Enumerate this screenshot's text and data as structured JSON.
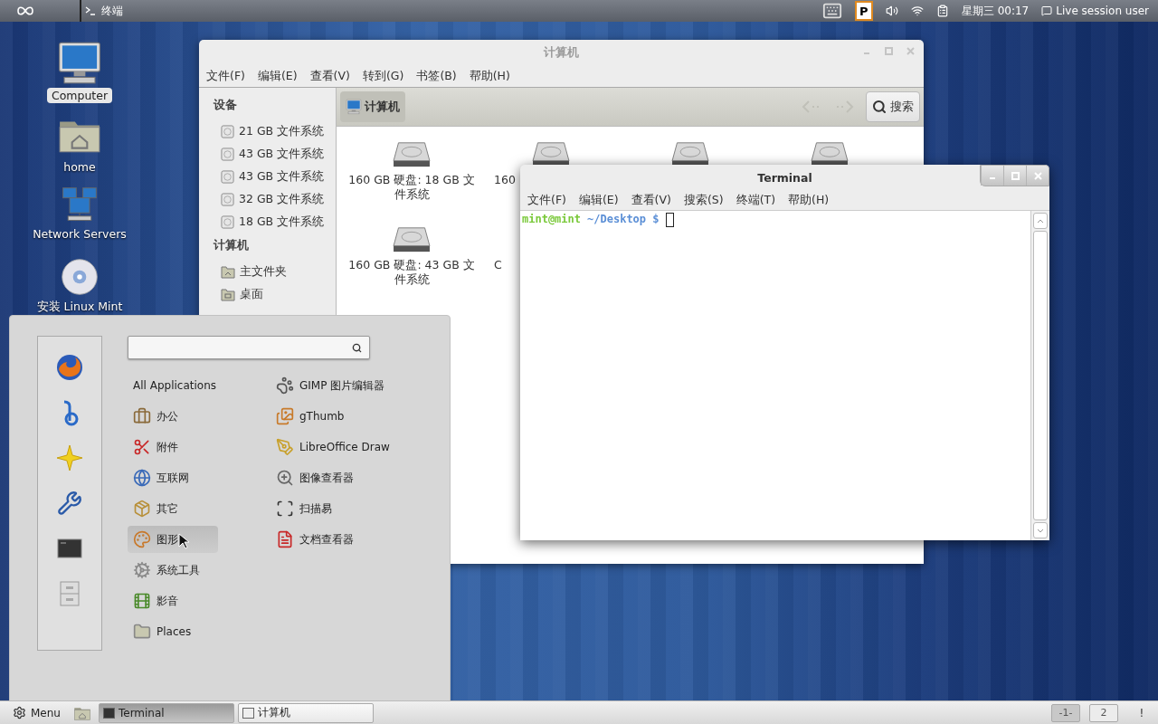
{
  "top_panel": {
    "window_list": [
      {
        "label": "终端"
      }
    ],
    "indicator": "P",
    "clock": "星期三 00:17",
    "user": "Live session user"
  },
  "desktop_icons": [
    {
      "label": "Computer",
      "kind": "computer",
      "selected": true
    },
    {
      "label": "home",
      "kind": "home",
      "selected": false
    },
    {
      "label": "Network Servers",
      "kind": "network",
      "selected": false
    },
    {
      "label": "安装 Linux Mint",
      "kind": "disc",
      "selected": false
    }
  ],
  "file_manager": {
    "title": "计算机",
    "menu": [
      "文件(F)",
      "编辑(E)",
      "查看(V)",
      "转到(G)",
      "书签(B)",
      "帮助(H)"
    ],
    "location": "计算机",
    "search_button": "搜索",
    "sidebar": [
      {
        "heading": "设备",
        "items": [
          {
            "label": "21 GB 文件系统",
            "kind": "drive"
          },
          {
            "label": "43 GB 文件系统",
            "kind": "drive"
          },
          {
            "label": "43 GB 文件系统",
            "kind": "drive"
          },
          {
            "label": "32 GB 文件系统",
            "kind": "drive"
          },
          {
            "label": "18 GB 文件系统",
            "kind": "drive"
          }
        ]
      },
      {
        "heading": "计算机",
        "items": [
          {
            "label": "主文件夹",
            "kind": "home"
          },
          {
            "label": "桌面",
            "kind": "folder"
          }
        ]
      }
    ],
    "items": [
      {
        "kind": "drive",
        "label": "160 GB 硬盘: 18 GB 文件系统"
      },
      {
        "kind": "drive_cut",
        "label": "160"
      },
      {
        "kind": "drive"
      },
      {
        "kind": "drive"
      },
      {
        "kind": "drive",
        "label": "160 GB 硬盘: 43 GB 文件系统"
      },
      {
        "kind": "text_cut",
        "label": "C"
      }
    ]
  },
  "terminal": {
    "title": "Terminal",
    "menu": [
      "文件(F)",
      "编辑(E)",
      "查看(V)",
      "搜索(S)",
      "终端(T)",
      "帮助(H)"
    ],
    "prompt_user": "mint@mint",
    "prompt_path": "~/Desktop $"
  },
  "menu": {
    "categories": [
      {
        "label": "All Applications",
        "selected": false
      },
      {
        "label": "办公",
        "selected": false
      },
      {
        "label": "附件",
        "selected": false
      },
      {
        "label": "互联网",
        "selected": false
      },
      {
        "label": "其它",
        "selected": false
      },
      {
        "label": "图形",
        "selected": true
      },
      {
        "label": "系统工具",
        "selected": false
      },
      {
        "label": "影音",
        "selected": false
      },
      {
        "label": "Places",
        "selected": false
      }
    ],
    "apps": [
      "GIMP 图片编辑器",
      "gThumb",
      "LibreOffice Draw",
      "图像查看器",
      "扫描易",
      "文档查看器"
    ]
  },
  "taskbar": {
    "menu_button": "Menu",
    "tasks": [
      {
        "label": "Terminal",
        "selected": true
      },
      {
        "label": "计算机",
        "selected": false
      }
    ],
    "workspaces": [
      {
        "label": "-1-",
        "selected": true
      },
      {
        "label": "2",
        "selected": false
      }
    ],
    "notice": "!"
  }
}
